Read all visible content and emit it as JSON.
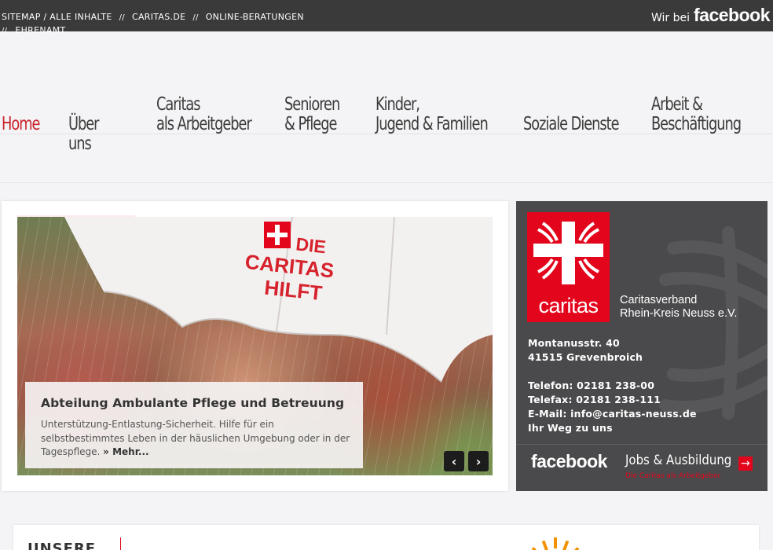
{
  "topbar": {
    "links": [
      "SITEMAP / ALLE INHALTE",
      "CARITAS.DE",
      "ONLINE-BERATUNGEN",
      "EHRENAMT"
    ],
    "separator": "//",
    "fb_prefix": "Wir bei",
    "fb_logo": "facebook"
  },
  "nav": {
    "items": [
      {
        "l1": "Home",
        "l2": ""
      },
      {
        "l1": "Über",
        "l2": "uns"
      },
      {
        "l1": "Caritas",
        "l2": "als Arbeitgeber"
      },
      {
        "l1": "Senioren",
        "l2": "& Pflege"
      },
      {
        "l1": "Kinder,",
        "l2": "Jugend & Familien"
      },
      {
        "l1": "Soziale Dienste",
        "l2": ""
      },
      {
        "l1": "Arbeit &",
        "l2": "Beschäftigung"
      }
    ]
  },
  "slider": {
    "umbrella_text": [
      "DIE",
      "CARITAS",
      "HILFT"
    ],
    "title": "Abteilung Ambulante Pflege und Betreuung",
    "text": "Unterstützung-Entlastung-Sicherheit. Hilfe für ein selbstbestimmtes Leben in der häuslichen Umgebung oder in der Tagespflege.",
    "more": "» Mehr...",
    "prev": "‹",
    "next": "›"
  },
  "contact": {
    "logo_word": "caritas",
    "org_line1": "Caritasverband",
    "org_line2": "Rhein-Kreis Neuss e.V.",
    "street": "Montanusstr. 40",
    "city": "41515 Grevenbroich",
    "phone": "Telefon: 02181 238-00",
    "fax": "Telefax: 02181 238-111",
    "email": "E-Mail: info@caritas-neuss.de",
    "directions": "Ihr Weg zu uns",
    "facebook": "facebook",
    "jobs": "Jobs & Ausbildung",
    "jobs_sub": "Die Caritas als Arbeitgeber",
    "jobs_arrow": "→"
  },
  "bottom": {
    "label": "UNSERE"
  },
  "colors": {
    "caritas_red": "#e3051b",
    "nav_active": "#c8232c",
    "topbar": "#3a3a3a",
    "contact_bg": "#4a4a4c"
  }
}
